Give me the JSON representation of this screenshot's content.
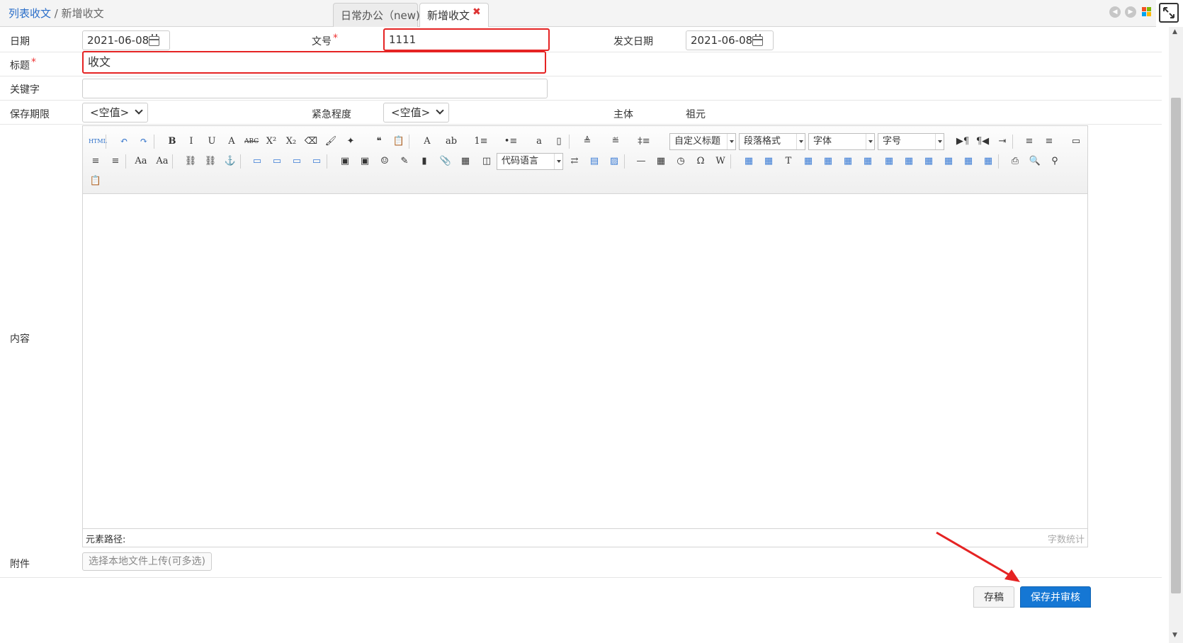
{
  "breadcrumb": {
    "parent": "列表收文",
    "separator": " / ",
    "current": "新增收文"
  },
  "tabs": [
    {
      "label": "日常办公（new)"
    },
    {
      "label": "新增收文",
      "close": "✖"
    }
  ],
  "form": {
    "date_label": "日期",
    "date_value": "2021-06-08",
    "docno_label": "文号",
    "docno_value": "1111",
    "issue_date_label": "发文日期",
    "issue_date_value": "2021-06-08",
    "title_label": "标题",
    "title_value": "收文",
    "keyword_label": "关键字",
    "keyword_value": "",
    "retention_label": "保存期限",
    "retention_value": "<空值>",
    "urgency_label": "紧急程度",
    "urgency_value": "<空值>",
    "subject_label": "主体",
    "subject_value": "祖元",
    "content_label": "内容",
    "attachment_label": "附件",
    "upload_label": "选择本地文件上传(可多选)",
    "required_mark": "*"
  },
  "editor": {
    "toolbar_combos": {
      "custom_title": "自定义标题",
      "paragraph": "段落格式",
      "font": "字体",
      "font_size": "字号",
      "code_lang": "代码语言"
    },
    "toolbar_glyphs": {
      "html": "HTML",
      "undo": "↶",
      "redo": "↷",
      "bold": "B",
      "italic": "I",
      "underline": "U",
      "font_border": "A",
      "strike": "ABC",
      "sup": "X²",
      "sub": "X₂",
      "eraser": "⌫",
      "brush": "🖌",
      "magic": "✦",
      "quote": "❝",
      "paste": "📋",
      "font_color": "A",
      "highlight": "ab",
      "ordered": "1≡",
      "unordered": "•≡",
      "at": "a",
      "blank": "▯",
      "row_spacing_top": "≜",
      "row_spacing_bottom": "≝",
      "line_height": "‡≡",
      "ltr": "▶¶",
      "rtl": "¶◀",
      "indent": "⇥",
      "align_left": "≡",
      "align_center": "≡",
      "fullscreen": "▭",
      "align_right": "≡",
      "justify": "≡",
      "upper": "Aa",
      "lower": "Aa",
      "link": "⛓",
      "unlink": "⛓",
      "anchor": "⚓",
      "img_none": "▭",
      "img_left": "▭",
      "img_right": "▭",
      "img_center": "▭",
      "image": "▣",
      "multi_image": "▣",
      "emotion": "☺",
      "scrawl": "✎",
      "video": "▮",
      "attach": "📎",
      "map": "▦",
      "frame": "◫",
      "pagebreak": "⇄",
      "template": "▤",
      "background": "▨",
      "hr": "—",
      "date": "▦",
      "time": "◷",
      "special_char": "Ω",
      "word": "W",
      "table": "▦",
      "del_table": "▦",
      "table_title": "T",
      "ins_row": "▦",
      "del_row": "▦",
      "ins_col": "▦",
      "del_col": "▦",
      "merge": "▦",
      "merge_right": "▦",
      "merge_down": "▦",
      "split": "▦",
      "split_row": "▦",
      "split_col": "▦",
      "print": "⎙",
      "preview": "🔍",
      "search": "⚲",
      "paste_plain": "📋"
    },
    "element_path_label": "元素路径:",
    "word_count_label": "字数统计"
  },
  "buttons": {
    "draft": "存稿",
    "save_review": "保存并审核"
  },
  "colors": {
    "highlight_red": "#e52323",
    "primary_blue": "#1577d4",
    "link_blue": "#2a6ec9"
  }
}
